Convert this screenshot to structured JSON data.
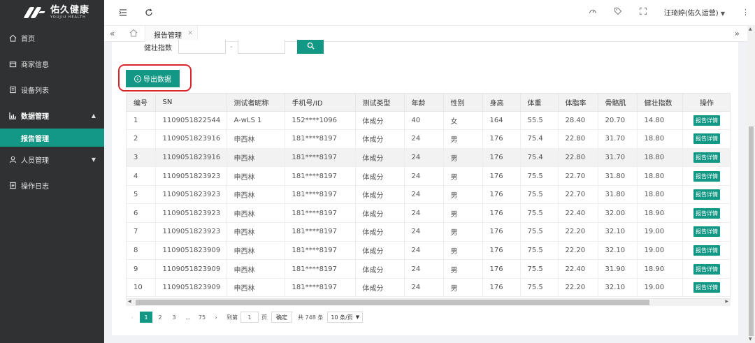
{
  "logo": {
    "name": "佑久健康",
    "sub": "YOUJIU HEALTH"
  },
  "sidebar": {
    "items": [
      {
        "label": "首页",
        "icon": "home-icon"
      },
      {
        "label": "商家信息",
        "icon": "store-icon"
      },
      {
        "label": "设备列表",
        "icon": "device-icon"
      },
      {
        "label": "数据管理",
        "icon": "bar-chart-icon",
        "expanded": true
      },
      {
        "label": "报告管理",
        "active": true
      },
      {
        "label": "人员管理",
        "icon": "user-icon"
      },
      {
        "label": "操作日志",
        "icon": "log-icon"
      }
    ]
  },
  "header": {
    "user": "汪琦婷(佑久运营)"
  },
  "tabs": [
    {
      "label": "报告管理"
    }
  ],
  "filter": {
    "label": "健壮指数",
    "separator": "-"
  },
  "export_label": "导出数据",
  "table": {
    "columns": [
      "编号",
      "SN",
      "测试者昵称",
      "手机号/ID",
      "测试类型",
      "年龄",
      "性别",
      "身高",
      "体重",
      "体脂率",
      "骨骼肌",
      "健壮指数",
      "操作"
    ],
    "rows": [
      [
        "1",
        "1109051822544",
        "A-wLS 1",
        "152****1096",
        "体成分",
        "40",
        "女",
        "164",
        "55.5",
        "28.40",
        "20.70",
        "14.80",
        "报告详情"
      ],
      [
        "2",
        "1109051823916",
        "申西林",
        "181****8197",
        "体成分",
        "24",
        "男",
        "176",
        "75.4",
        "22.80",
        "31.70",
        "18.80",
        "报告详情"
      ],
      [
        "3",
        "1109051823916",
        "申西林",
        "181****8197",
        "体成分",
        "24",
        "男",
        "176",
        "75.4",
        "22.80",
        "31.70",
        "18.80",
        "报告详情"
      ],
      [
        "4",
        "1109051823923",
        "申西林",
        "181****8197",
        "体成分",
        "24",
        "男",
        "176",
        "75.5",
        "22.70",
        "31.80",
        "18.80",
        "报告详情"
      ],
      [
        "5",
        "1109051823923",
        "申西林",
        "181****8197",
        "体成分",
        "24",
        "男",
        "176",
        "75.5",
        "22.70",
        "31.80",
        "18.80",
        "报告详情"
      ],
      [
        "6",
        "1109051823923",
        "申西林",
        "181****8197",
        "体成分",
        "24",
        "男",
        "176",
        "75.5",
        "22.40",
        "32.00",
        "18.90",
        "报告详情"
      ],
      [
        "7",
        "1109051823923",
        "申西林",
        "181****8197",
        "体成分",
        "24",
        "男",
        "176",
        "75.5",
        "22.20",
        "32.10",
        "19.00",
        "报告详情"
      ],
      [
        "8",
        "1109051823909",
        "申西林",
        "181****8197",
        "体成分",
        "24",
        "男",
        "176",
        "75.5",
        "22.20",
        "32.10",
        "19.00",
        "报告详情"
      ],
      [
        "9",
        "1109051823909",
        "申西林",
        "181****8197",
        "体成分",
        "24",
        "男",
        "176",
        "75.5",
        "22.40",
        "31.90",
        "18.90",
        "报告详情"
      ],
      [
        "10",
        "1109051823909",
        "申西林",
        "181****8197",
        "体成分",
        "24",
        "男",
        "176",
        "75.5",
        "22.20",
        "32.10",
        "19.00",
        "报告详情"
      ]
    ]
  },
  "pagination": {
    "pages": [
      "1",
      "2",
      "3",
      "…",
      "75"
    ],
    "current": "1",
    "goto_label": "到第",
    "goto_value": "1",
    "page_unit": "页",
    "confirm": "确定",
    "total": "共 748 条",
    "page_size": "10 条/页"
  },
  "colors": {
    "accent": "#149886",
    "sidebar": "#2f3133",
    "highlight": "#d9262d"
  }
}
